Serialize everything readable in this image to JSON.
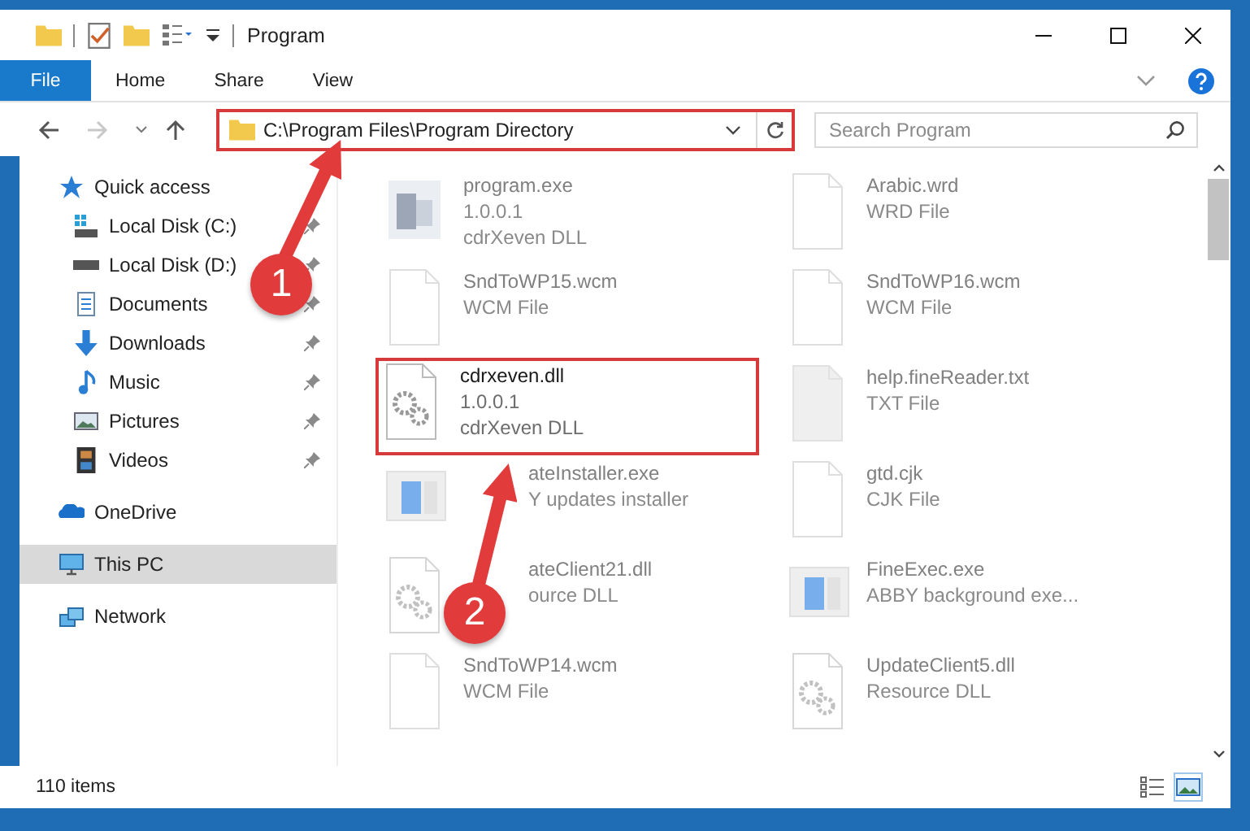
{
  "window": {
    "title": "Program"
  },
  "ribbon_tabs": [
    {
      "label": "File",
      "kind": "file",
      "selected": false
    },
    {
      "label": "Home",
      "kind": "tab",
      "selected": false
    },
    {
      "label": "Share",
      "kind": "tab",
      "selected": false
    },
    {
      "label": "View",
      "kind": "tab",
      "selected": false
    }
  ],
  "address_bar": {
    "path": "C:\\Program Files\\Program Directory",
    "highlighted": true
  },
  "search": {
    "placeholder": "Search Program"
  },
  "sidebar": [
    {
      "label": "Quick access",
      "selected": false,
      "children": [
        {
          "label": "Local Disk (C:)",
          "pinned": true,
          "selected": false
        },
        {
          "label": "Local Disk (D:)",
          "pinned": true,
          "selected": false
        },
        {
          "label": "Documents",
          "pinned": true,
          "selected": false
        },
        {
          "label": "Downloads",
          "pinned": true,
          "selected": false
        },
        {
          "label": "Music",
          "pinned": true,
          "selected": false
        },
        {
          "label": "Pictures",
          "pinned": true,
          "selected": false
        },
        {
          "label": "Videos",
          "pinned": true,
          "selected": false
        }
      ]
    },
    {
      "label": "OneDrive",
      "selected": false
    },
    {
      "label": "This PC",
      "selected": true
    },
    {
      "label": "Network",
      "selected": false
    }
  ],
  "files": [
    {
      "name": "program.exe",
      "details": [
        "1.0.0.1",
        "cdrXeven DLL"
      ],
      "kind": "app",
      "faded": true,
      "highlighted": false
    },
    {
      "name": "Arabic.wrd",
      "details": [
        "WRD File"
      ],
      "kind": "doc",
      "faded": true,
      "highlighted": false
    },
    {
      "name": "SndToWP15.wcm",
      "details": [
        "WCM File"
      ],
      "kind": "doc",
      "faded": true,
      "highlighted": false
    },
    {
      "name": "SndToWP16.wcm",
      "details": [
        "WCM File"
      ],
      "kind": "doc",
      "faded": true,
      "highlighted": false
    },
    {
      "name": "cdrxeven.dll",
      "details": [
        "1.0.0.1",
        "cdrXeven DLL"
      ],
      "kind": "dll",
      "faded": false,
      "highlighted": true
    },
    {
      "name": "help.fineReader.txt",
      "details": [
        "TXT File"
      ],
      "kind": "text",
      "faded": true,
      "highlighted": false
    },
    {
      "name": "ateInstaller.exe",
      "details": [
        "Y updates installer"
      ],
      "kind": "window",
      "faded": true,
      "highlighted": false,
      "covered": true
    },
    {
      "name": "gtd.cjk",
      "details": [
        "CJK File"
      ],
      "kind": "doc",
      "faded": true,
      "highlighted": false
    },
    {
      "name": "ateClient21.dll",
      "details": [
        "ource DLL"
      ],
      "kind": "dll",
      "faded": true,
      "highlighted": false,
      "covered": true
    },
    {
      "name": "FineExec.exe",
      "details": [
        "ABBY background exe..."
      ],
      "kind": "window",
      "faded": true,
      "highlighted": false
    },
    {
      "name": "SndToWP14.wcm",
      "details": [
        "WCM File"
      ],
      "kind": "doc",
      "faded": true,
      "highlighted": false
    },
    {
      "name": "UpdateClient5.dll",
      "details": [
        "Resource DLL"
      ],
      "kind": "dll",
      "faded": true,
      "highlighted": false
    }
  ],
  "status_bar": {
    "item_count": "110 items"
  },
  "callouts": [
    {
      "number": "1"
    },
    {
      "number": "2"
    }
  ]
}
